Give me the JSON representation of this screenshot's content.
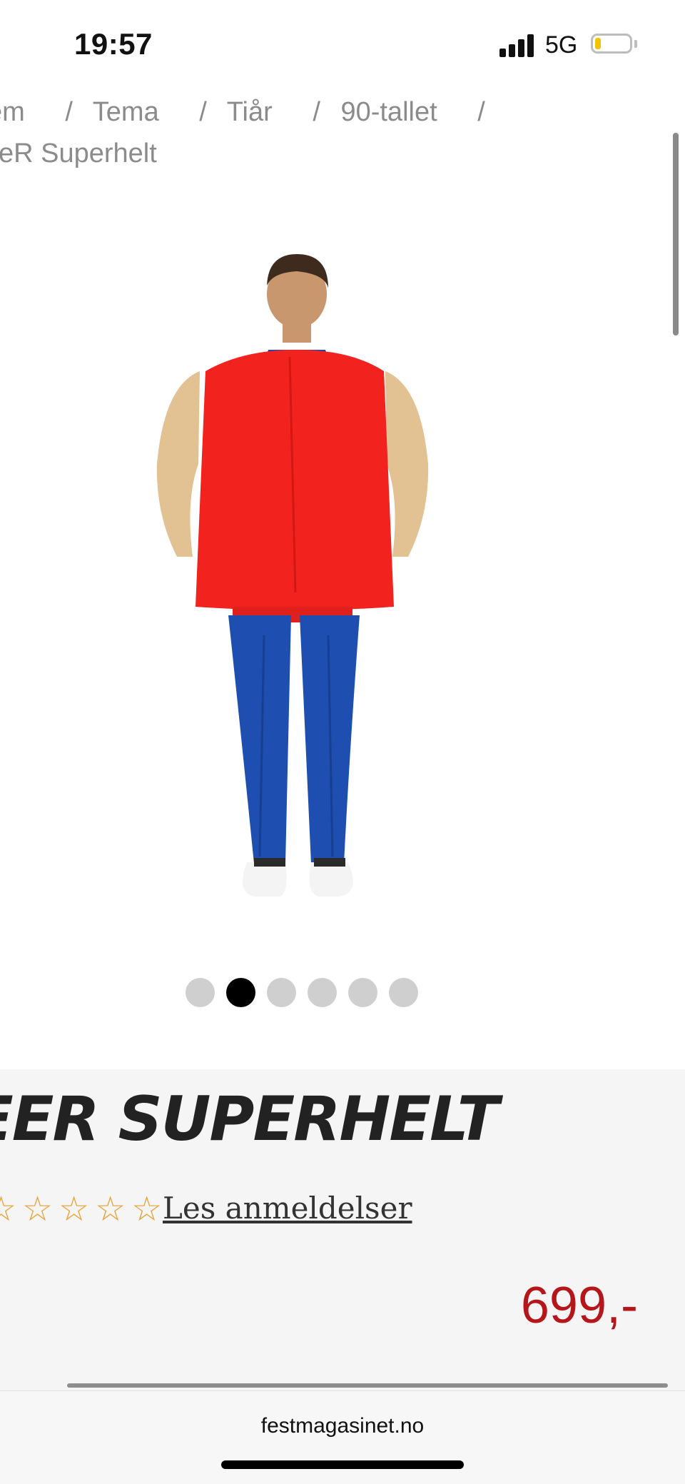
{
  "status_bar": {
    "time": "19:57",
    "network": "5G",
    "signal_icon": "signal-bars-icon",
    "battery_icon": "battery-icon"
  },
  "breadcrumb": {
    "items": [
      "em",
      "Tema",
      "Tiår",
      "90-tallet"
    ],
    "separator": "/",
    "current": "eR Superhelt"
  },
  "gallery": {
    "image_icon": "costume-back-view-image",
    "dots": 6,
    "active_index": 1
  },
  "product": {
    "title": "EER SUPERHELT",
    "rating_stars": 5,
    "reviews_label": "Les anmeldelser",
    "price": "699,-"
  },
  "browser": {
    "domain": "festmagasinet.no"
  },
  "colors": {
    "price": "#b5161b",
    "star": "#e8a33b",
    "panel_bg": "#f5f5f5"
  }
}
